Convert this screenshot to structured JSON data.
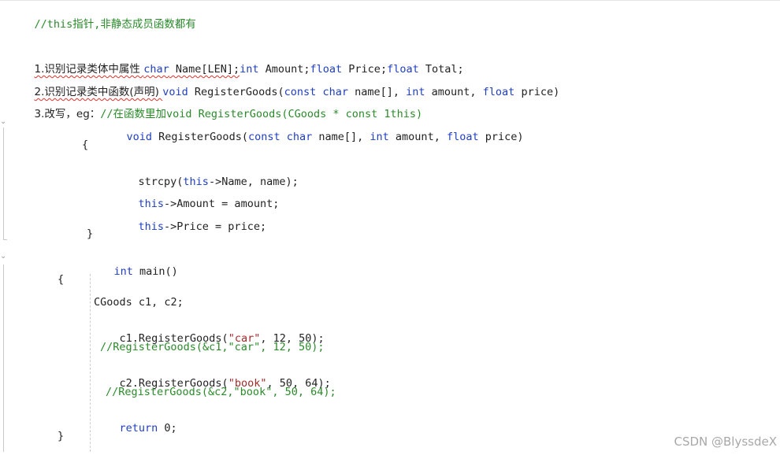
{
  "editor": {
    "comment_line": "//this指针,非静态成员函数都有",
    "item1": {
      "prefix": "1.识别记录类体中属性 ",
      "kw_char": "char",
      "name_part": " Name[LEN];",
      "kw_int": "int",
      "amount_part": " Amount;",
      "kw_float1": "float",
      "price_part": " Price;",
      "kw_float2": "float",
      "total_part": " Total;"
    },
    "item2": {
      "prefix": "2.识别记录类中函数(声明) ",
      "kw_void": "void",
      "fn": " RegisterGoods(",
      "kw_const": "const",
      "sp1": " ",
      "kw_char": "char",
      "p1": " name[], ",
      "kw_int": "int",
      "p2": " amount, ",
      "kw_float": "float",
      "p3": " price)"
    },
    "item3": {
      "prefix": "3.改写，eg：",
      "comment": "//在函数里加void RegisterGoods(CGoods * const 1this)"
    },
    "fn_def": {
      "kw_void": "void",
      "fn": " RegisterGoods(",
      "kw_const": "const",
      "sp1": " ",
      "kw_char": "char",
      "p1": " name[], ",
      "kw_int": "int",
      "p2": " amount, ",
      "kw_float": "float",
      "p3": " price)"
    },
    "open_brace1": "{",
    "strcpy_line": {
      "a": "strcpy(",
      "kw_this": "this",
      "b": "->Name, name);"
    },
    "amount_line": {
      "kw_this": "this",
      "b": "->Amount = amount;"
    },
    "price_line": {
      "kw_this": "this",
      "b": "->Price = price;"
    },
    "close_brace1": "}",
    "main_line": {
      "kw_int": "int",
      "b": " main()"
    },
    "open_brace2": "{",
    "decl_line": "CGoods c1, c2;",
    "call1": {
      "a": "c1.RegisterGoods(",
      "str": "\"car\"",
      "b": ", 12, 50);"
    },
    "call1_comment": "//RegisterGoods(&c1,\"car\", 12, 50);",
    "call2": {
      "a": "c2.RegisterGoods(",
      "str": "\"book\"",
      "b": ", 50, 64);"
    },
    "call2_comment": "//RegisterGoods(&c2,\"book\", 50, 64);",
    "return_line": {
      "kw_return": "return",
      "b": " 0;"
    },
    "close_brace2": "}"
  },
  "watermark": "CSDN @BlyssdeX",
  "colors": {
    "keyword": "#1f3fbf",
    "comment": "#2a8a2a",
    "string": "#a52a2a",
    "text": "#222222"
  },
  "icons": {
    "fold_marker_1": "chevron-down-icon",
    "fold_marker_2": "chevron-down-icon"
  }
}
